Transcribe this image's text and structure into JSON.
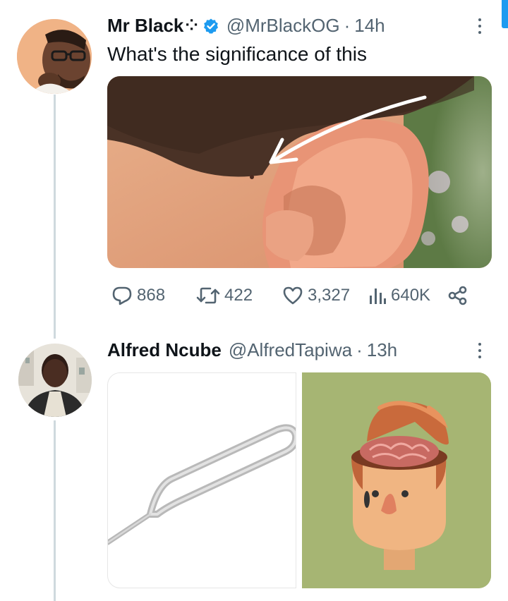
{
  "tweets": [
    {
      "name": "Mr Black",
      "name_deco": "⁘",
      "handle": "@MrBlackOG",
      "time": "14h",
      "text": "What's the significance of this",
      "media_desc": "ear-closeup-image",
      "actions": {
        "replies": "868",
        "retweets": "422",
        "likes": "3,327",
        "views": "640K"
      }
    },
    {
      "name": "Alfred Ncube",
      "handle": "@AlfredTapiwa",
      "time": "13h"
    }
  ],
  "separator": "·",
  "colors": {
    "verified": "#1d9bf0",
    "text_primary": "#0f1419",
    "text_secondary": "#536471",
    "thread_line": "#cfd9de",
    "scroll_indicator": "#1d9bf0"
  },
  "icons": [
    "verified-badge-icon",
    "more-options-icon",
    "reply-icon",
    "retweet-icon",
    "like-icon",
    "views-icon",
    "share-icon"
  ]
}
